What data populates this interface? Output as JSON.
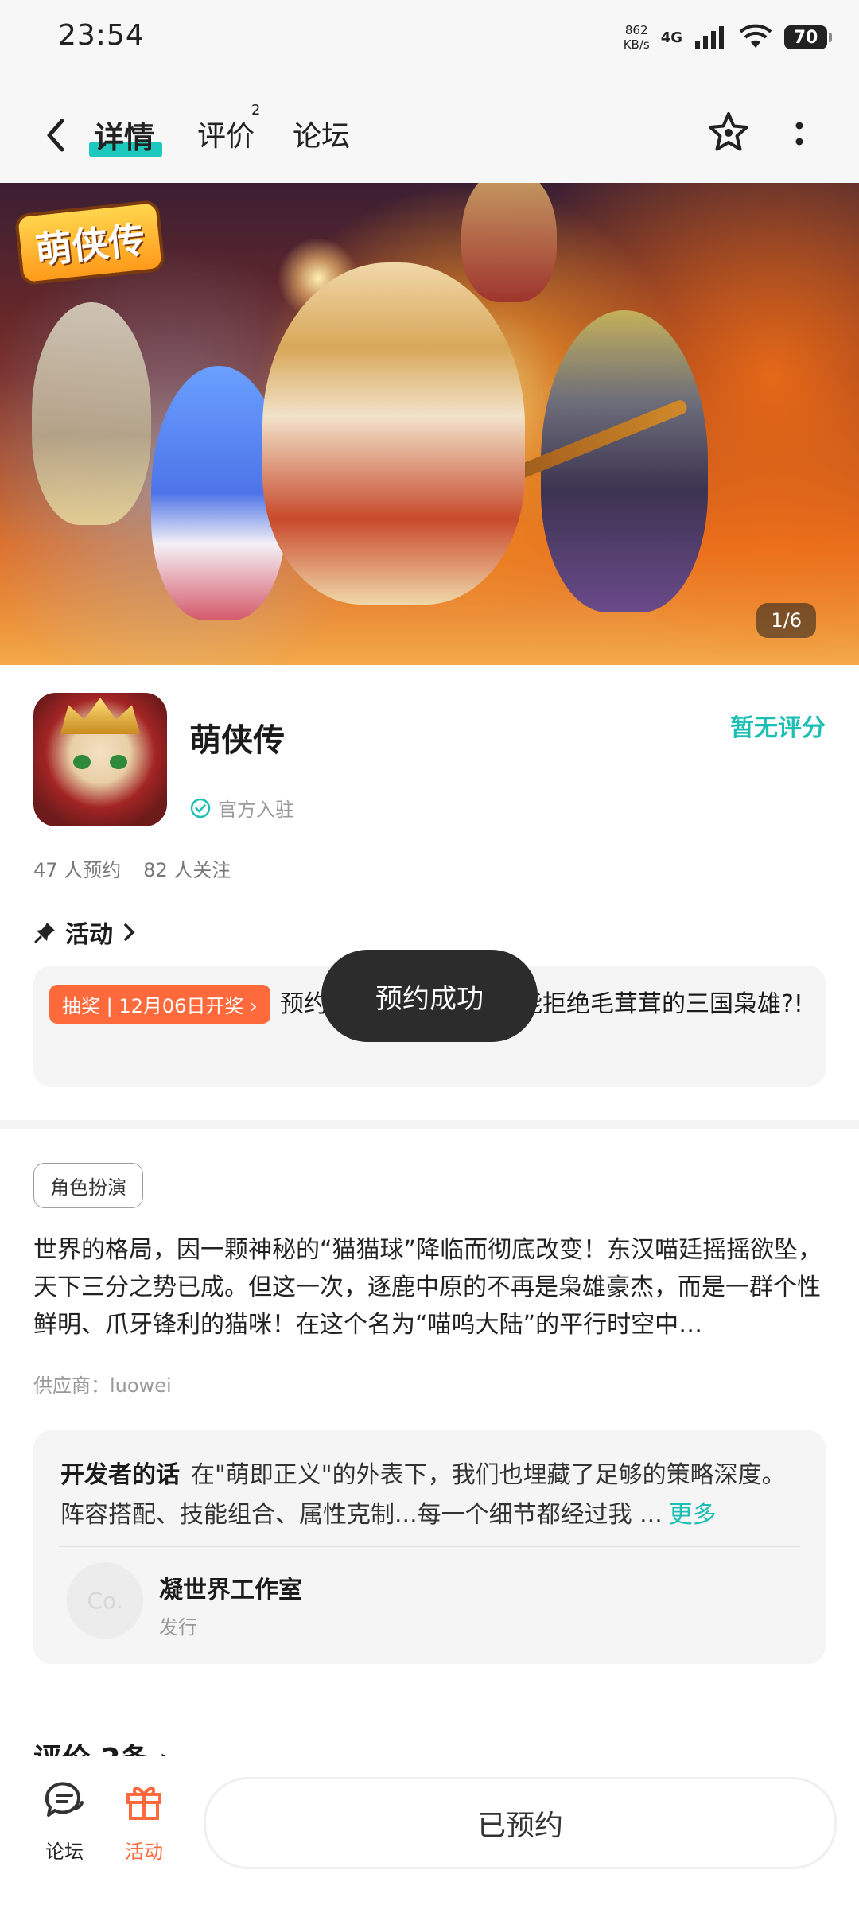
{
  "status_bar": {
    "time": "23:54",
    "net_speed_value": "862",
    "net_speed_unit": "KB/s",
    "network": "4G",
    "battery": "70"
  },
  "nav": {
    "tabs": [
      {
        "label": "详情",
        "active": true
      },
      {
        "label": "评价",
        "badge": "2"
      },
      {
        "label": "论坛"
      }
    ],
    "icons": [
      "back-arrow-icon",
      "star-icon",
      "more-vertical-icon"
    ]
  },
  "banner": {
    "logo_text": "萌侠传",
    "counter": "1/6"
  },
  "app": {
    "name": "萌侠传",
    "rating_text": "暂无评分",
    "verified_label": "官方入驻",
    "reservations": "47 人预约",
    "followers": "82 人关注"
  },
  "activity": {
    "heading": "活动",
    "tag": "抽奖 | 12月06日开奖 ›",
    "text": "预约即可参与抽奖！谁能拒绝毛茸茸的三国枭雄?!"
  },
  "toast": "预约成功",
  "genre_tag": "角色扮演",
  "description": "世界的格局，因一颗神秘的“猫猫球”降临而彻底改变！东汉喵廷摇摇欲坠，天下三分之势已成。但这一次，逐鹿中原的不再是枭雄豪杰，而是一群个性鲜明、爪牙锋利的猫咪！在这个名为“喵呜大陆”的平行时空中…",
  "supplier": "供应商：luowei",
  "developer": {
    "label": "开发者的话",
    "text": "在\"萌即正义\"的外表下，我们也埋藏了足够的策略深度。阵容搭配、技能组合、属性克制...每一个细节都经过我 ...",
    "more": "更多",
    "studio_initials": "Co.",
    "studio_name": "凝世界工作室",
    "studio_role": "发行"
  },
  "reviews_heading": "评价 2条 ›",
  "bottom_bar": {
    "forum_label": "论坛",
    "activity_label": "活动",
    "reserve_button": "已预约"
  },
  "colors": {
    "accent": "#1dc8be",
    "orange": "#ff6a3d",
    "toast_bg": "#2c2c2c"
  }
}
